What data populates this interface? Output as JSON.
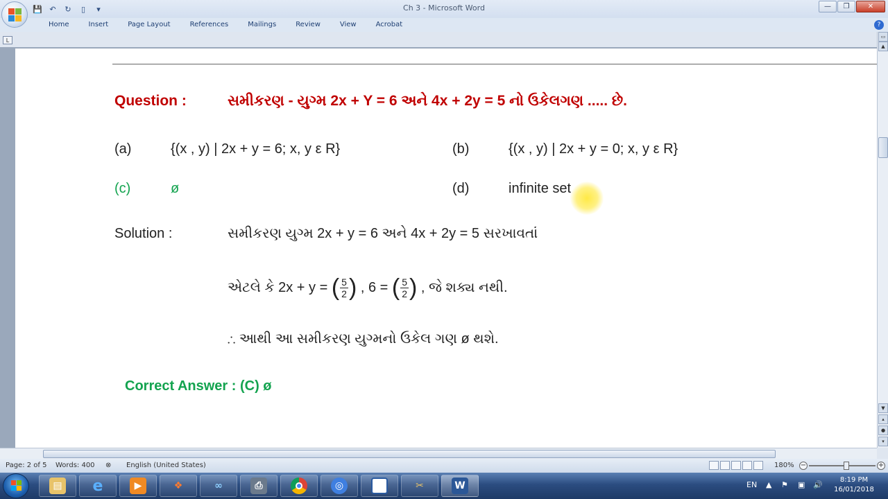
{
  "window": {
    "title": "Ch 3 - Microsoft Word",
    "controls": {
      "minimize": "—",
      "restore": "❐",
      "close": "✕"
    }
  },
  "ribbon": {
    "tabs": [
      "Home",
      "Insert",
      "Page Layout",
      "References",
      "Mailings",
      "Review",
      "View",
      "Acrobat"
    ],
    "help": "?"
  },
  "document": {
    "question_label": "Question  :",
    "question_text": "સમીકરણ - યુગ્મ  2x + Y = 6  અને  4x + 2y = 5  નો ઉકેલગણ  ..... છે.",
    "options": [
      {
        "key": "(a)",
        "text": "{(x , y) | 2x + y = 6; x, y ε R}"
      },
      {
        "key": "(b)",
        "text": "{(x , y) | 2x + y = 0; x, y ε R}"
      },
      {
        "key": "(c)",
        "text": "ø"
      },
      {
        "key": "(d)",
        "text": "infinite set"
      }
    ],
    "solution_label": "Solution  :",
    "solution_line1": "સમીકરણ યુગ્મ  2x + y = 6  અને  4x + 2y = 5   સરખાવતાં",
    "solution_line2_prefix": "એટલે કે  2x + y =",
    "solution_line2_mid": ", 6 =",
    "solution_line2_suffix": ", જે શક્ય નથી.",
    "frac_num": "5",
    "frac_den": "2",
    "solution_line3": "∴ આથી આ સમીકરણ યુગ્મનો ઉકેલ ગણ ø થશે.",
    "correct_answer": "Correct Answer :  (C)   ø"
  },
  "statusbar": {
    "page": "Page: 2 of 5",
    "words": "Words: 400",
    "language": "English (United States)",
    "zoom": "180%"
  },
  "taskbar": {
    "language": "EN",
    "time": "8:19 PM",
    "date": "16/01/2018"
  },
  "colors": {
    "question_red": "#c00000",
    "answer_green": "#13a34f"
  }
}
